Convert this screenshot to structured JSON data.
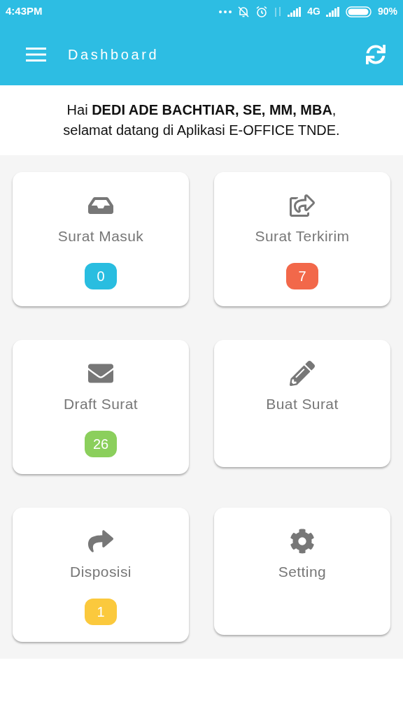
{
  "status_bar": {
    "time": "4:43PM",
    "network": "4G",
    "battery": "90%"
  },
  "app_bar": {
    "title": "Dashboard"
  },
  "greeting": [
    "Hai **DEDI ADE BACHTIAR, SE, MM, MBA**,",
    "selamat datang di Aplikasi E-OFFICE TNDE."
  ],
  "cards": [
    {
      "label": "Surat Masuk",
      "badge": "0",
      "color": "#29bde0"
    },
    {
      "label": "Surat Terkirim",
      "badge": "7",
      "color": "#f2684a"
    },
    {
      "label": "Draft Surat",
      "badge": "26",
      "color": "#8bcf5c"
    },
    {
      "label": "Buat Surat"
    },
    {
      "label": "Disposisi",
      "badge": "1",
      "color": "#fbc93d"
    },
    {
      "label": "Setting"
    }
  ]
}
